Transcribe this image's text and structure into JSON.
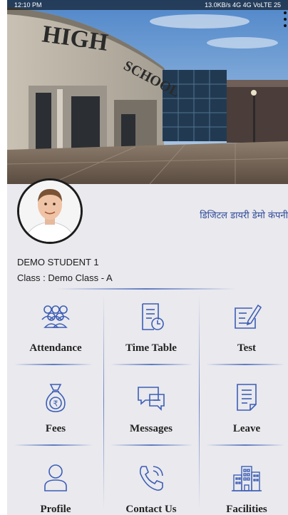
{
  "status_bar": {
    "time": "12:10 PM",
    "info": "13.0KB/s  4G  4G  VoLTE  25"
  },
  "banner": {
    "sign_text": "HIGH SCHOOL"
  },
  "profile": {
    "company_name": "डिजिटल डायरी डेमो कंपनी",
    "student_name": "DEMO STUDENT 1",
    "class_text": "Class : Demo Class - A"
  },
  "menu": {
    "tiles": [
      {
        "label": "Attendance",
        "icon": "attendance-icon"
      },
      {
        "label": "Time Table",
        "icon": "timetable-icon"
      },
      {
        "label": "Test",
        "icon": "test-icon"
      },
      {
        "label": "Fees",
        "icon": "fees-icon"
      },
      {
        "label": "Messages",
        "icon": "messages-icon"
      },
      {
        "label": "Leave",
        "icon": "leave-icon"
      },
      {
        "label": "Profile",
        "icon": "profile-icon"
      },
      {
        "label": "Contact Us",
        "icon": "contact-icon"
      },
      {
        "label": "Facilities",
        "icon": "facilities-icon"
      }
    ]
  },
  "colors": {
    "icon_blue": "#3d5eb5",
    "company_text": "#2f4a98",
    "background": "#e9e9ee"
  }
}
